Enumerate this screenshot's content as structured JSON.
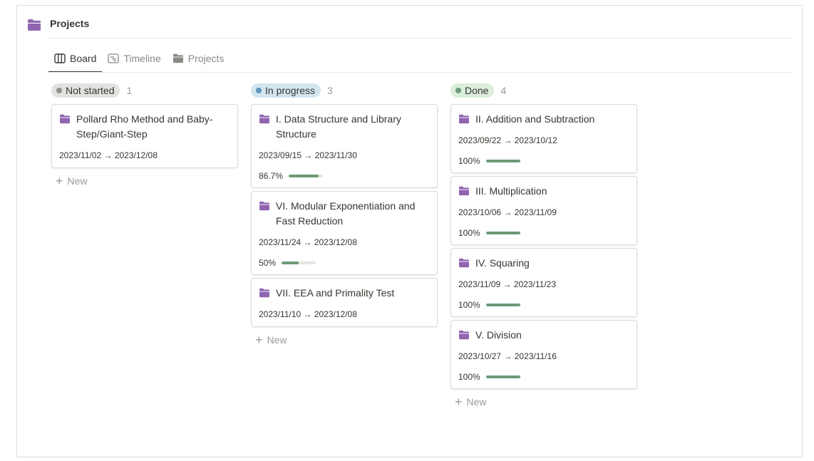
{
  "header": {
    "title": "Projects",
    "icon": "folder-icon"
  },
  "tabs": [
    {
      "label": "Board",
      "icon": "board-icon",
      "active": true
    },
    {
      "label": "Timeline",
      "icon": "timeline-icon",
      "active": false
    },
    {
      "label": "Projects",
      "icon": "folder-icon",
      "active": false
    }
  ],
  "colors": {
    "folder": "#9065b0",
    "progress": "#6b9a78"
  },
  "columns": [
    {
      "status": "Not started",
      "count": "1",
      "badge_bg": "#e3e2e0",
      "dot": "#91918e",
      "new_label": "New",
      "cards": [
        {
          "title": "Pollard Rho Method and Baby-Step/Giant-Step",
          "dates": "2023/11/02 → 2023/12/08"
        }
      ]
    },
    {
      "status": "In progress",
      "count": "3",
      "badge_bg": "#d3e5ef",
      "dot": "#5b97bd",
      "new_label": "New",
      "cards": [
        {
          "title": "I. Data Structure and Library Structure",
          "dates": "2023/09/15 → 2023/11/30",
          "progress_label": "86.7%",
          "progress": 0.867
        },
        {
          "title": "VI. Modular Exponentiation and Fast Reduction",
          "dates": "2023/11/24 → 2023/12/08",
          "progress_label": "50%",
          "progress": 0.5
        },
        {
          "title": "VII. EEA and Primality Test",
          "dates": "2023/11/10 → 2023/12/08"
        }
      ]
    },
    {
      "status": "Done",
      "count": "4",
      "badge_bg": "#dbeddb",
      "dot": "#6c9b7d",
      "new_label": "New",
      "cards": [
        {
          "title": "II. Addition and Subtraction",
          "dates": "2023/09/22 → 2023/10/12",
          "progress_label": "100%",
          "progress": 1.0
        },
        {
          "title": "III. Multiplication",
          "dates": "2023/10/06 → 2023/11/09",
          "progress_label": "100%",
          "progress": 1.0
        },
        {
          "title": "IV. Squaring",
          "dates": "2023/11/09 → 2023/11/23",
          "progress_label": "100%",
          "progress": 1.0
        },
        {
          "title": "V. Division",
          "dates": "2023/10/27 → 2023/11/16",
          "progress_label": "100%",
          "progress": 1.0
        }
      ]
    }
  ]
}
